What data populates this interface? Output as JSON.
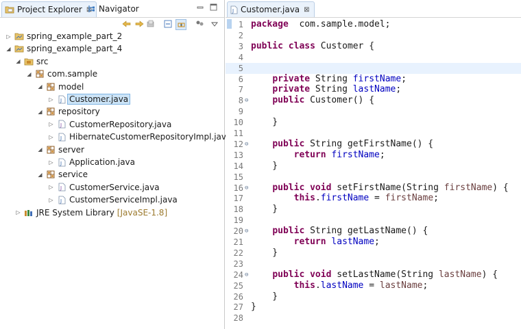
{
  "left_panel": {
    "tabs": [
      {
        "label": "Project Explorer",
        "close": "⊠",
        "active": true
      },
      {
        "label": "Navigator",
        "active": false
      }
    ],
    "tree": [
      {
        "label": "spring_example_part_2",
        "level": 0,
        "expand": "collapsed",
        "icon": "project-folder-icon"
      },
      {
        "label": "spring_example_part_4",
        "level": 0,
        "expand": "expanded",
        "icon": "project-folder-icon"
      },
      {
        "label": "src",
        "level": 1,
        "expand": "expanded",
        "icon": "source-folder-icon"
      },
      {
        "label": "com.sample",
        "level": 2,
        "expand": "expanded",
        "icon": "package-icon"
      },
      {
        "label": "model",
        "level": 3,
        "expand": "expanded",
        "icon": "package-icon"
      },
      {
        "label": "Customer.java",
        "level": 4,
        "expand": "collapsed",
        "icon": "java-file-icon",
        "selected": true
      },
      {
        "label": "repository",
        "level": 3,
        "expand": "expanded",
        "icon": "package-icon"
      },
      {
        "label": "CustomerRepository.java",
        "level": 4,
        "expand": "collapsed",
        "icon": "java-interface-file-icon"
      },
      {
        "label": "HibernateCustomerRepositoryImpl.java",
        "level": 4,
        "expand": "collapsed",
        "icon": "java-file-icon"
      },
      {
        "label": "server",
        "level": 3,
        "expand": "expanded",
        "icon": "package-icon"
      },
      {
        "label": "Application.java",
        "level": 4,
        "expand": "collapsed",
        "icon": "java-file-icon"
      },
      {
        "label": "service",
        "level": 3,
        "expand": "expanded",
        "icon": "package-icon"
      },
      {
        "label": "CustomerService.java",
        "level": 4,
        "expand": "collapsed",
        "icon": "java-interface-file-icon"
      },
      {
        "label": "CustomerServiceImpl.java",
        "level": 4,
        "expand": "collapsed",
        "icon": "java-file-icon"
      },
      {
        "label": "JRE System Library",
        "decoration": "[JavaSE-1.8]",
        "level": 1,
        "expand": "collapsed",
        "icon": "library-icon"
      }
    ]
  },
  "editor": {
    "tab": {
      "label": "Customer.java",
      "close": "⊠"
    },
    "current_line": 5,
    "lines": [
      {
        "n": "1",
        "tokens": [
          [
            "kw",
            "package"
          ],
          [
            "",
            "  com.sample.model;"
          ]
        ]
      },
      {
        "n": "2",
        "tokens": []
      },
      {
        "n": "3",
        "tokens": [
          [
            "kw",
            "public"
          ],
          [
            "",
            " "
          ],
          [
            "kw",
            "class"
          ],
          [
            "",
            " Customer {"
          ]
        ]
      },
      {
        "n": "4",
        "tokens": []
      },
      {
        "n": "5",
        "tokens": []
      },
      {
        "n": "6",
        "tokens": [
          [
            "",
            "    "
          ],
          [
            "kw",
            "private"
          ],
          [
            "",
            " String "
          ],
          [
            "fld",
            "firstName"
          ],
          [
            "",
            ";"
          ]
        ]
      },
      {
        "n": "7",
        "tokens": [
          [
            "",
            "    "
          ],
          [
            "kw",
            "private"
          ],
          [
            "",
            " String "
          ],
          [
            "fld",
            "lastName"
          ],
          [
            "",
            ";"
          ]
        ]
      },
      {
        "n": "8",
        "fold": "⊖",
        "tokens": [
          [
            "",
            "    "
          ],
          [
            "kw",
            "public"
          ],
          [
            "",
            " Customer() {"
          ]
        ]
      },
      {
        "n": "9",
        "tokens": []
      },
      {
        "n": "10",
        "tokens": [
          [
            "",
            "    }"
          ]
        ]
      },
      {
        "n": "11",
        "tokens": []
      },
      {
        "n": "12",
        "fold": "⊖",
        "tokens": [
          [
            "",
            "    "
          ],
          [
            "kw",
            "public"
          ],
          [
            "",
            " String getFirstName() {"
          ]
        ]
      },
      {
        "n": "13",
        "tokens": [
          [
            "",
            "        "
          ],
          [
            "kw",
            "return"
          ],
          [
            "",
            " "
          ],
          [
            "fld",
            "firstName"
          ],
          [
            "",
            ";"
          ]
        ]
      },
      {
        "n": "14",
        "tokens": [
          [
            "",
            "    }"
          ]
        ]
      },
      {
        "n": "15",
        "tokens": []
      },
      {
        "n": "16",
        "fold": "⊖",
        "tokens": [
          [
            "",
            "    "
          ],
          [
            "kw",
            "public"
          ],
          [
            "",
            " "
          ],
          [
            "kw",
            "void"
          ],
          [
            "",
            " setFirstName(String "
          ],
          [
            "prm",
            "firstName"
          ],
          [
            "",
            ") {"
          ]
        ]
      },
      {
        "n": "17",
        "tokens": [
          [
            "",
            "        "
          ],
          [
            "kw",
            "this"
          ],
          [
            "",
            "."
          ],
          [
            "fld",
            "firstName"
          ],
          [
            "",
            " = "
          ],
          [
            "prm",
            "firstName"
          ],
          [
            "",
            ";"
          ]
        ]
      },
      {
        "n": "18",
        "tokens": [
          [
            "",
            "    }"
          ]
        ]
      },
      {
        "n": "19",
        "tokens": []
      },
      {
        "n": "20",
        "fold": "⊖",
        "tokens": [
          [
            "",
            "    "
          ],
          [
            "kw",
            "public"
          ],
          [
            "",
            " String getLastName() {"
          ]
        ]
      },
      {
        "n": "21",
        "tokens": [
          [
            "",
            "        "
          ],
          [
            "kw",
            "return"
          ],
          [
            "",
            " "
          ],
          [
            "fld",
            "lastName"
          ],
          [
            "",
            ";"
          ]
        ]
      },
      {
        "n": "22",
        "tokens": [
          [
            "",
            "    }"
          ]
        ]
      },
      {
        "n": "23",
        "tokens": []
      },
      {
        "n": "24",
        "fold": "⊖",
        "tokens": [
          [
            "",
            "    "
          ],
          [
            "kw",
            "public"
          ],
          [
            "",
            " "
          ],
          [
            "kw",
            "void"
          ],
          [
            "",
            " setLastName(String "
          ],
          [
            "prm",
            "lastName"
          ],
          [
            "",
            ") {"
          ]
        ]
      },
      {
        "n": "25",
        "tokens": [
          [
            "",
            "        "
          ],
          [
            "kw",
            "this"
          ],
          [
            "",
            "."
          ],
          [
            "fld",
            "lastName"
          ],
          [
            "",
            " = "
          ],
          [
            "prm",
            "lastName"
          ],
          [
            "",
            ";"
          ]
        ]
      },
      {
        "n": "26",
        "tokens": [
          [
            "",
            "    }"
          ]
        ]
      },
      {
        "n": "27",
        "tokens": [
          [
            "",
            "}"
          ]
        ]
      },
      {
        "n": "28",
        "tokens": []
      }
    ]
  },
  "colors": {
    "keyword": "#7f0055",
    "field": "#0000c0",
    "parameter": "#6a3e3e",
    "selection": "#cce4f7",
    "current_line": "#e8f2fe"
  }
}
